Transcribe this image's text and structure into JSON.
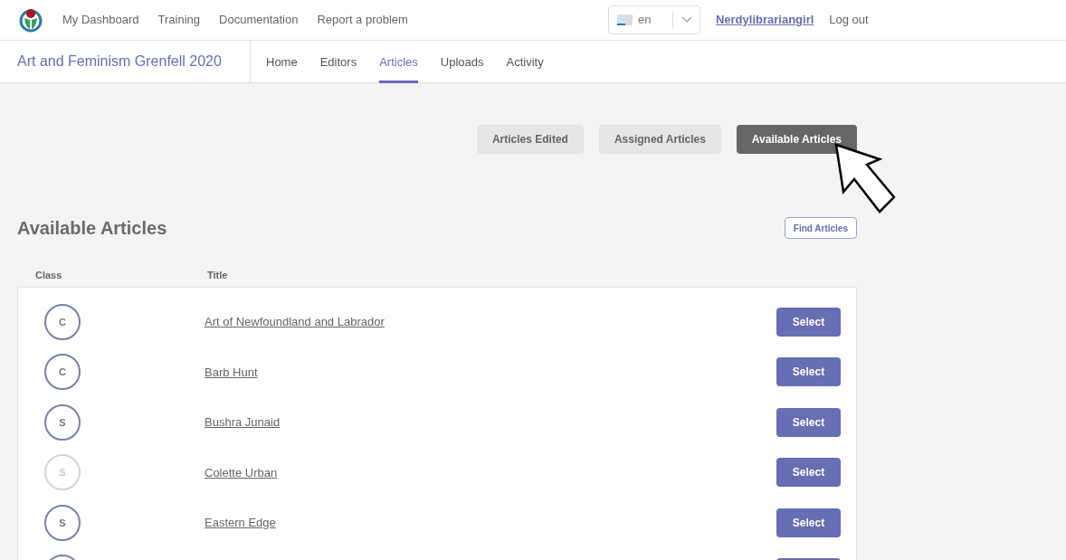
{
  "top_nav": {
    "links": [
      "My Dashboard",
      "Training",
      "Documentation",
      "Report a problem"
    ],
    "language": "en",
    "username": "Nerdylibrariangirl",
    "logout": "Log out"
  },
  "course_nav": {
    "title": "Art and Feminism Grenfell 2020",
    "tabs": [
      {
        "label": "Home",
        "selected": false
      },
      {
        "label": "Editors",
        "selected": false
      },
      {
        "label": "Articles",
        "selected": true
      },
      {
        "label": "Uploads",
        "selected": false
      },
      {
        "label": "Activity",
        "selected": false
      }
    ]
  },
  "view_buttons": [
    {
      "label": "Articles Edited",
      "selected": false
    },
    {
      "label": "Assigned Articles",
      "selected": false
    },
    {
      "label": "Available Articles",
      "selected": true
    }
  ],
  "section": {
    "title": "Available Articles",
    "action": "Find Articles"
  },
  "table": {
    "columns": [
      "Class",
      "Title"
    ],
    "rows": [
      {
        "kind": "full",
        "class": "C",
        "faded": false,
        "title": "Art of Newfoundland and Labrador",
        "action": "Select"
      },
      {
        "kind": "full",
        "class": "C",
        "faded": false,
        "title": "Barb Hunt",
        "action": "Select"
      },
      {
        "kind": "full",
        "class": "S",
        "faded": false,
        "title": "Bushra Junaid",
        "action": "Select"
      },
      {
        "kind": "full",
        "class": "S",
        "faded": true,
        "title": "Colette Urban",
        "action": "Select"
      },
      {
        "kind": "full",
        "class": "S",
        "faded": false,
        "title": "Eastern Edge",
        "action": "Select"
      },
      {
        "kind": "clipped",
        "faded": false
      }
    ]
  }
}
